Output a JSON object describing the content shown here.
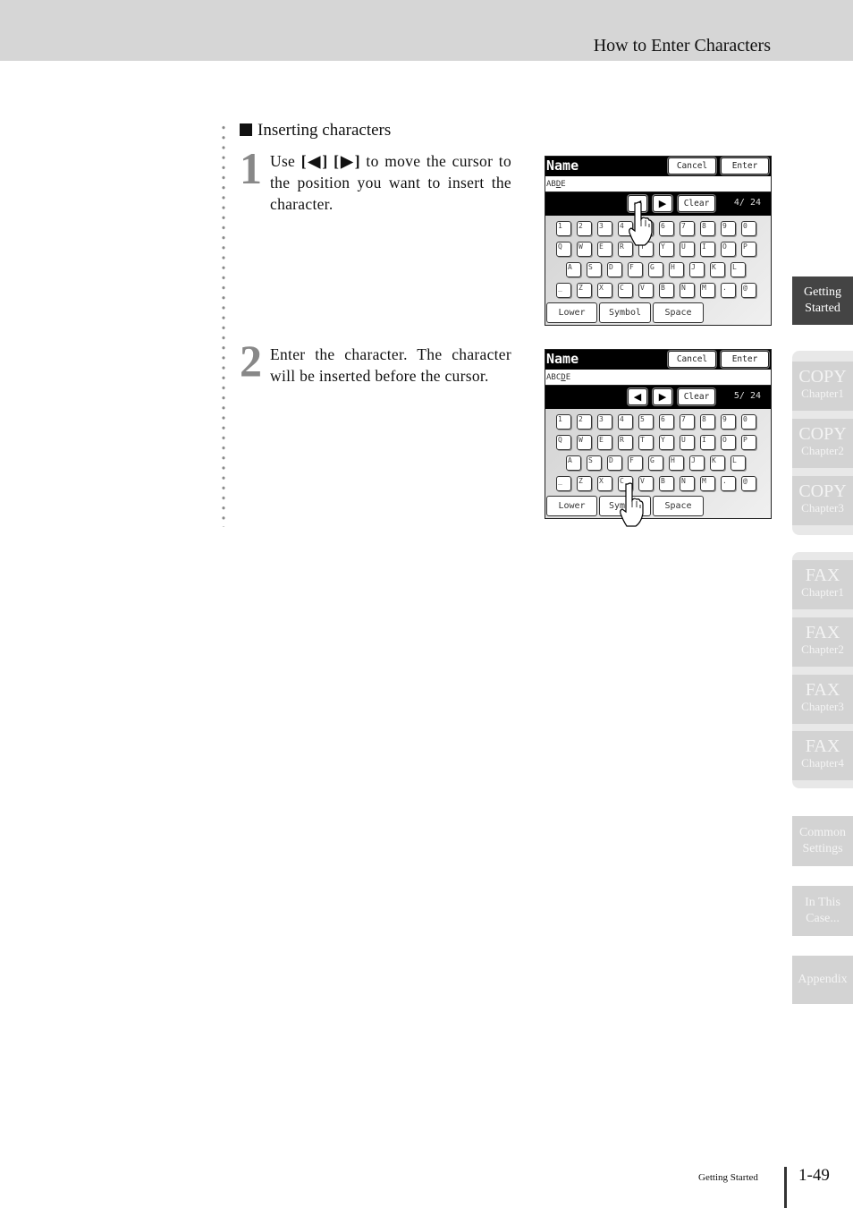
{
  "header": {
    "title": "How to Enter Characters"
  },
  "section": {
    "heading": "Inserting characters"
  },
  "steps": [
    {
      "number": "1",
      "text_prefix": "Use ",
      "key_left": "[◀]",
      "key_right": "[▶]",
      "text_suffix": " to move the cursor to the position you want to insert the character."
    },
    {
      "number": "2",
      "text": "Enter the character. The character will be inserted before the cursor."
    }
  ],
  "panels": [
    {
      "title": "Name",
      "cancel_label": "Cancel",
      "enter_label": "Enter",
      "field_before_cursor": "AB",
      "field_cursor": "D",
      "field_after_cursor": "E",
      "left_arrow": "◀",
      "right_arrow": "▶",
      "clear_label": "Clear",
      "counter": "4/ 24",
      "pressed_key": "left-arrow"
    },
    {
      "title": "Name",
      "cancel_label": "Cancel",
      "enter_label": "Enter",
      "field_before_cursor": "ABC",
      "field_cursor": "D",
      "field_after_cursor": "E",
      "left_arrow": "◀",
      "right_arrow": "▶",
      "clear_label": "Clear",
      "counter": "5/ 24",
      "pressed_key": "C"
    }
  ],
  "keyboard": {
    "rows": [
      [
        "1",
        "2",
        "3",
        "4",
        "5",
        "6",
        "7",
        "8",
        "9",
        "0"
      ],
      [
        "Q",
        "W",
        "E",
        "R",
        "T",
        "Y",
        "U",
        "I",
        "O",
        "P"
      ],
      [
        "A",
        "S",
        "D",
        "F",
        "G",
        "H",
        "J",
        "K",
        "L"
      ],
      [
        "_",
        "Z",
        "X",
        "C",
        "V",
        "B",
        "N",
        "M",
        ".",
        "@"
      ]
    ],
    "lower_label": "Lower",
    "symbol_label": "Symbol",
    "space_label": "Space"
  },
  "side_tabs": [
    {
      "big": "Getting",
      "small": "Started",
      "active": true
    },
    {
      "big": "COPY",
      "small": "Chapter1"
    },
    {
      "big": "COPY",
      "small": "Chapter2"
    },
    {
      "big": "COPY",
      "small": "Chapter3"
    },
    {
      "big": "FAX",
      "small": "Chapter1"
    },
    {
      "big": "FAX",
      "small": "Chapter2"
    },
    {
      "big": "FAX",
      "small": "Chapter3"
    },
    {
      "big": "FAX",
      "small": "Chapter4"
    },
    {
      "big": "Common",
      "small": "Settings"
    },
    {
      "big": "In This",
      "small": "Case..."
    },
    {
      "big": "Appendix",
      "small": ""
    }
  ],
  "footer": {
    "section": "Getting Started",
    "page": "1-49"
  }
}
